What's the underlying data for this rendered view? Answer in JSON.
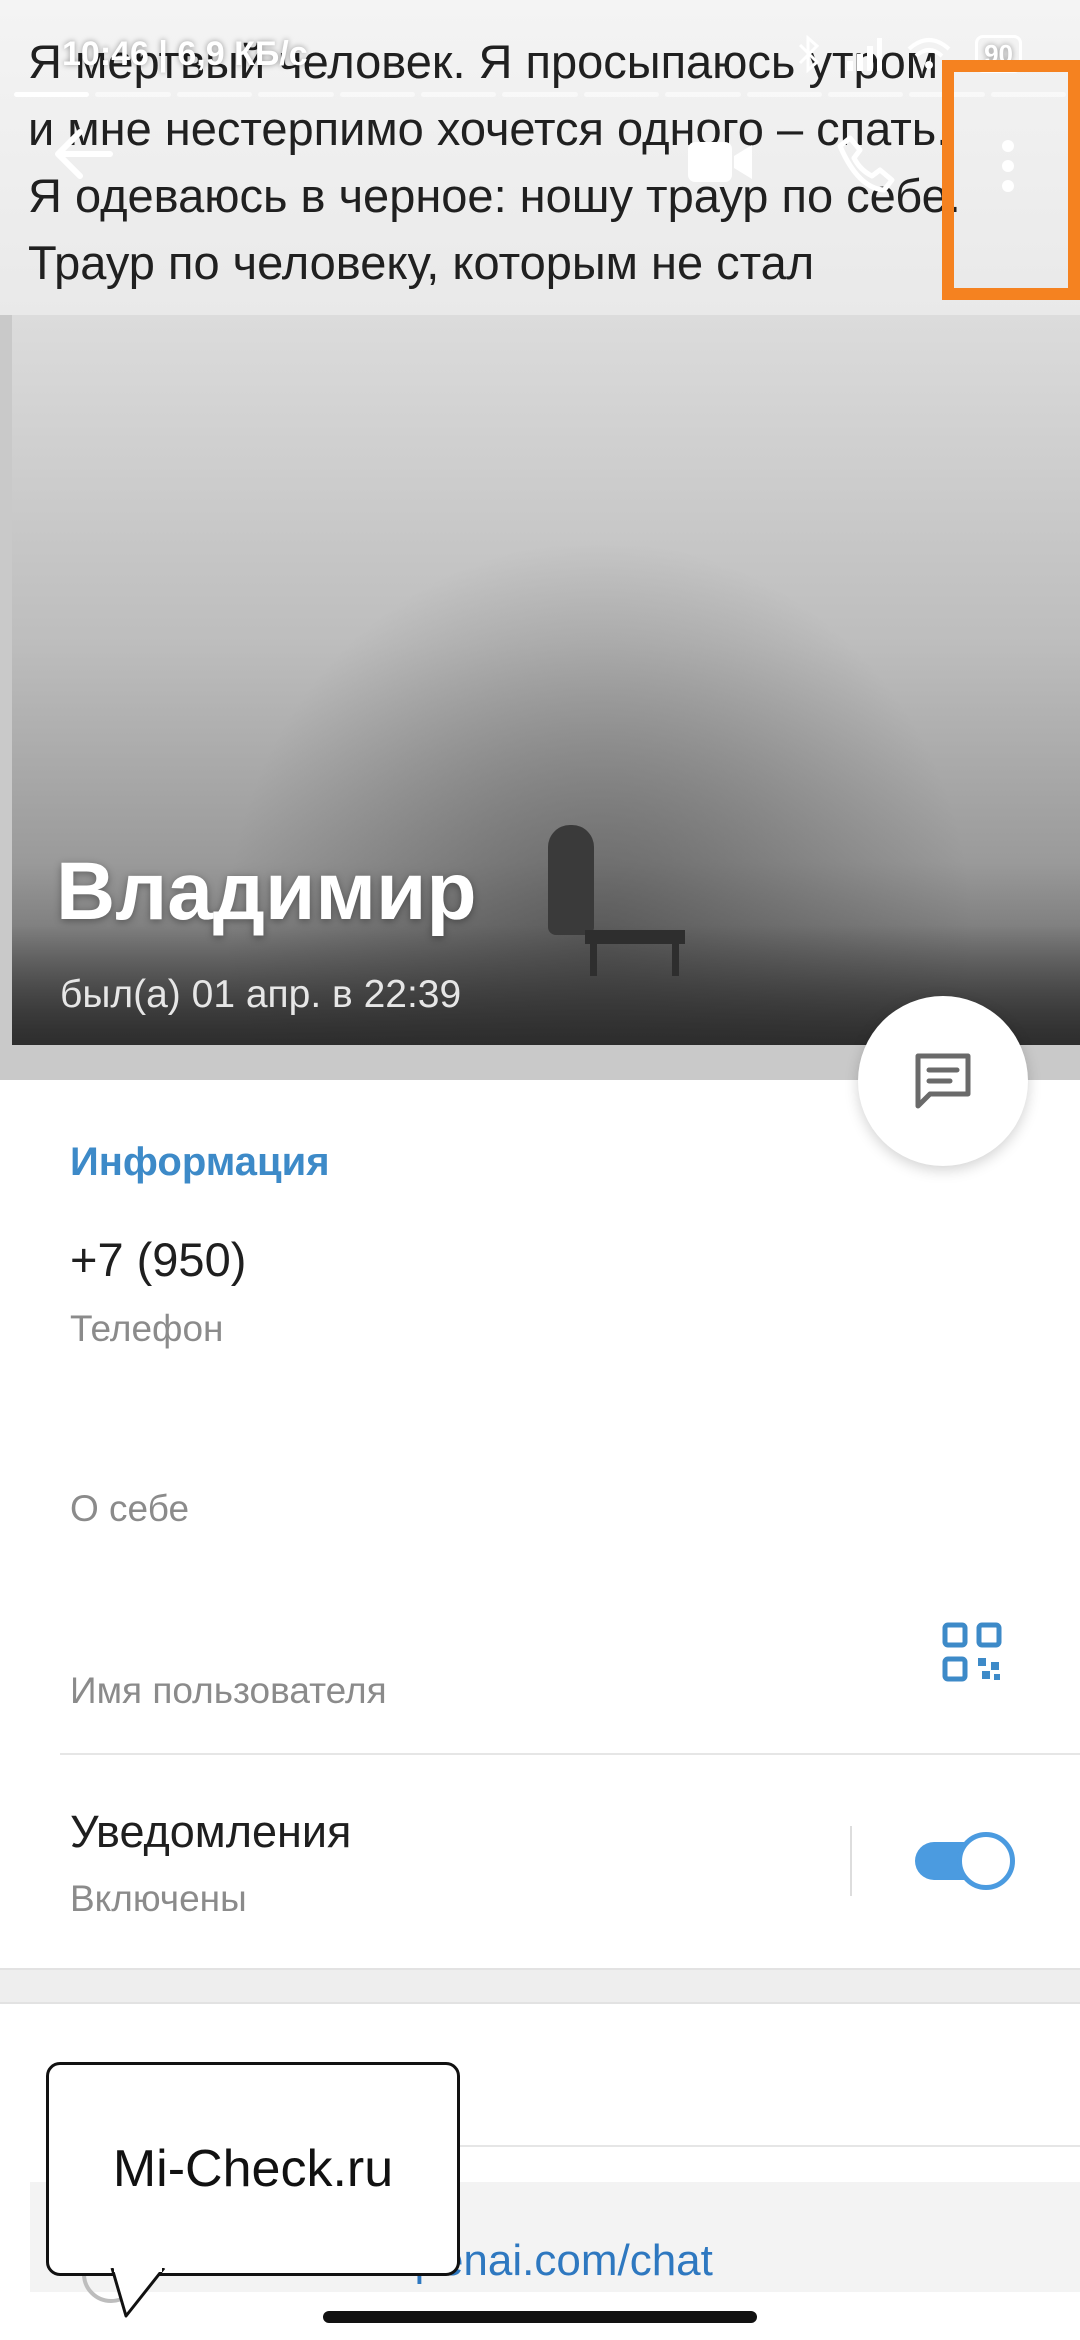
{
  "status_bar": {
    "time_speed": "10:46 | 6,9 КБ/с",
    "battery": "90"
  },
  "story": {
    "text": "Я мертвый человек. Я просыпаюсь утром\nи мне нестерпимо хочется одного – спать.\nЯ одеваюсь в черное: ношу траур по себе.\nТраур по человеку, которым не стал"
  },
  "toolbar": {
    "back_icon": "arrow-left-icon",
    "video_icon": "video-camera-icon",
    "call_icon": "phone-icon",
    "more_icon": "more-vertical-icon",
    "highlight_color": "#f58220"
  },
  "profile": {
    "name": "Владимир",
    "last_seen": "был(а) 01 апр. в 22:39",
    "message_button_icon": "message-icon"
  },
  "info": {
    "section_title": "Информация",
    "phone": "+7 (950)",
    "phone_label": "Телефон",
    "bio_label": "О себе",
    "username_label": "Имя пользователя",
    "qr_icon": "qr-code-icon"
  },
  "notifications": {
    "title": "Уведомления",
    "state": "Включены",
    "enabled": true,
    "accent": "#4b9be0"
  },
  "bottom": {
    "link_text": "openai.com/chat"
  },
  "watermark": {
    "text": "Mi-Check.ru"
  }
}
